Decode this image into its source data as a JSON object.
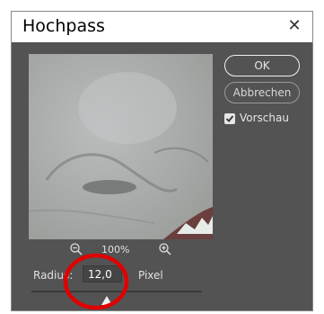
{
  "dialog": {
    "title": "Hochpass",
    "close_glyph": "✕",
    "close_icon": "close-icon"
  },
  "buttons": {
    "ok_label": "OK",
    "cancel_label": "Abbrechen"
  },
  "preview_option": {
    "label": "Vorschau",
    "checked": true
  },
  "zoom": {
    "level": "100%",
    "zoom_out_icon": "zoom-out-icon",
    "zoom_in_icon": "zoom-in-icon"
  },
  "radius": {
    "label": "Radius:",
    "value": "12,0",
    "unit": "Pixel",
    "slider_position": 0.44
  },
  "colors": {
    "dialog_bg": "#535353",
    "annotation": "#e00000"
  }
}
